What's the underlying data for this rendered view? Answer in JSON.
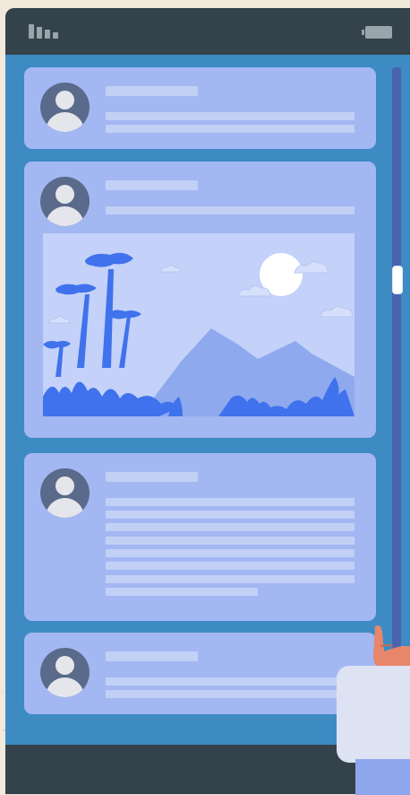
{
  "colors": {
    "background": "#f1e9dc",
    "screen": "#3d8bc2",
    "status_bar": "#34424b",
    "card": "#a3b7f3",
    "text_placeholder": "#c2d0f6",
    "image_sky": "#c4d1f8",
    "tree": "#3f72ec",
    "mountain": "#8ea9ee",
    "sun": "#ffffff"
  },
  "icons": {
    "signal": "signal-icon",
    "battery": "battery-icon",
    "avatar": "user-avatar-icon",
    "landscape": "landscape-image-icon",
    "hand": "hand-icon"
  },
  "feed": {
    "posts": [
      {
        "id": "post-1",
        "has_image": false,
        "text_lines": 2
      },
      {
        "id": "post-2",
        "has_image": true,
        "text_lines": 1
      },
      {
        "id": "post-3",
        "has_image": false,
        "text_lines": 8
      },
      {
        "id": "post-4",
        "has_image": false,
        "text_lines": 2
      }
    ]
  },
  "scrollbar": {
    "position_fraction": 0.3
  }
}
